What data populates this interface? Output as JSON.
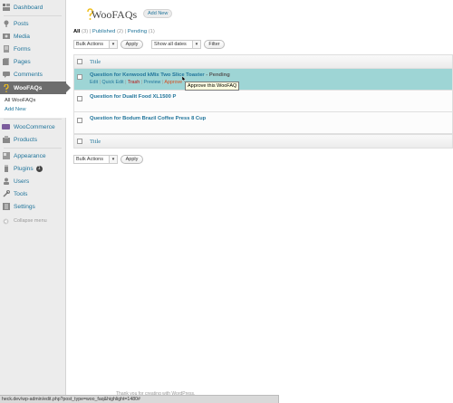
{
  "sidebar": {
    "items": [
      {
        "label": "Dashboard",
        "icon": "dashboard-icon"
      },
      {
        "label": "Posts",
        "icon": "pin-icon"
      },
      {
        "label": "Media",
        "icon": "media-icon"
      },
      {
        "label": "Forms",
        "icon": "forms-icon"
      },
      {
        "label": "Pages",
        "icon": "pages-icon"
      },
      {
        "label": "Comments",
        "icon": "comments-icon"
      },
      {
        "label": "WooFAQs",
        "icon": "question-icon"
      },
      {
        "label": "WooCommerce",
        "icon": "woocommerce-icon"
      },
      {
        "label": "Products",
        "icon": "products-icon"
      },
      {
        "label": "Appearance",
        "icon": "appearance-icon"
      },
      {
        "label": "Plugins",
        "icon": "plugins-icon"
      },
      {
        "label": "Users",
        "icon": "users-icon"
      },
      {
        "label": "Tools",
        "icon": "tools-icon"
      },
      {
        "label": "Settings",
        "icon": "settings-icon"
      }
    ],
    "submenu": [
      "All WooFAQs",
      "Add New"
    ],
    "plugins_badge": "1",
    "collapse_label": "Collapse menu"
  },
  "header": {
    "title": "WooFAQs",
    "add_new": "Add New"
  },
  "subsubsub": {
    "all": "All",
    "all_count": "(3)",
    "published": "Published",
    "published_count": "(2)",
    "pending": "Pending",
    "pending_count": "(1)"
  },
  "bulk_actions": {
    "selected": "Bulk Actions",
    "apply": "Apply",
    "dates_selected": "Show all dates",
    "filter": "Filter"
  },
  "table": {
    "column_title": "Title",
    "rows": [
      {
        "title": "Question for Kenwood kMix Two Slice Toaster",
        "status": "- Pending",
        "actions": [
          "Edit",
          "Quick Edit",
          "Trash",
          "Preview",
          "Approve"
        ]
      },
      {
        "title": "Question for Dualit Food XL1500 P",
        "status": ""
      },
      {
        "title": "Question for Bodum Brazil Coffee Press 8 Cup",
        "status": ""
      }
    ],
    "tooltip": "Approve this WooFAQ"
  },
  "footer": {
    "thank_you": "Thank you for creating with WordPress.",
    "status_url": "heck.dev/wp-admin/edit.php?post_type=woo_faq&highlight=1480#"
  },
  "colors": {
    "link": "#21759b",
    "highlight_row": "#9ed5d5",
    "active_menu": "#6d6d6d",
    "approve": "#d54e21",
    "trash": "#bc0b0b"
  }
}
